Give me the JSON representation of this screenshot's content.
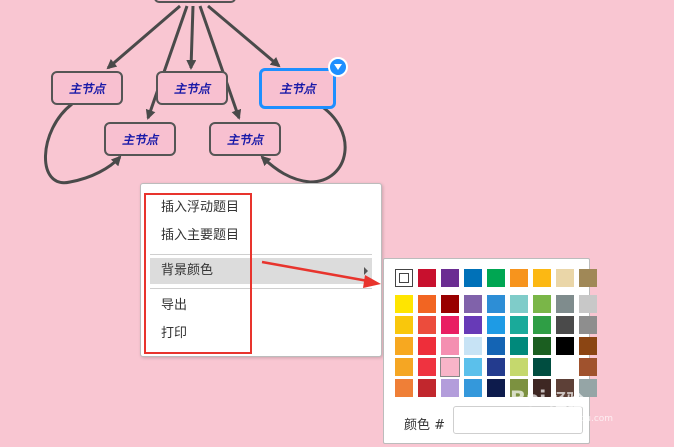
{
  "mindmap": {
    "node_label": "主节点",
    "nodes": [
      {
        "id": "n1",
        "label": "主节点",
        "selected": false
      },
      {
        "id": "n2",
        "label": "主节点",
        "selected": false
      },
      {
        "id": "n3",
        "label": "主节点",
        "selected": true
      },
      {
        "id": "n4",
        "label": "主节点",
        "selected": false
      },
      {
        "id": "n5",
        "label": "主节点",
        "selected": false
      }
    ]
  },
  "context_menu": {
    "items": [
      {
        "label": "插入浮动题目"
      },
      {
        "label": "插入主要题目"
      },
      {
        "label": "背景颜色",
        "has_submenu": true,
        "highlighted": true
      },
      {
        "label": "导出"
      },
      {
        "label": "打印"
      }
    ]
  },
  "color_palette": {
    "label": "颜色 #",
    "hex_value": "",
    "top_row": [
      "none",
      "#c8102e",
      "#6b2d92",
      "#0071b8",
      "#00a652",
      "#f7941d",
      "#fcb813",
      "#ead6a8",
      "#a08857"
    ],
    "grid": [
      [
        "#ffe500",
        "#f26522",
        "#990000",
        "#8062aa",
        "#2d8ed6",
        "#7fccc9",
        "#7ab648",
        "#7f8c8d",
        "#c8c8c8"
      ],
      [
        "#f9c70c",
        "#ec4c3c",
        "#e91e63",
        "#673ab7",
        "#1e9be5",
        "#1aaa9a",
        "#2f9e45",
        "#4a4a4a",
        "#8e8e8e"
      ],
      [
        "#f7a820",
        "#ee2e3a",
        "#f48fb1",
        "#c7e3f5",
        "#1464b4",
        "#00897b",
        "#1b5e20",
        "#000000",
        "#8b4513"
      ],
      [
        "#f5a623",
        "#ef3340",
        "#f8b4c8",
        "#5bc0eb",
        "#233b8e",
        "#c5d86d",
        "#004d40",
        "#ffffff",
        "#a0522d"
      ],
      [
        "#ef7f37",
        "#c1272d",
        "#b39ddb",
        "#3498db",
        "#0d1b4c",
        "#7c9140",
        "#3e2723",
        "#5d4037",
        "#95a5a6"
      ]
    ],
    "picked": {
      "row": 3,
      "col": 2
    }
  },
  "watermark": {
    "brand": "Bai",
    "brand_cn": "经验",
    "sub": "jingyan.baidu.com"
  },
  "colors": {
    "background": "#f9c6d2",
    "node_fill": "#f8c0d0",
    "node_text": "#1a1aa8",
    "selection": "#1e8fff",
    "highlight_box": "#e8342d"
  }
}
